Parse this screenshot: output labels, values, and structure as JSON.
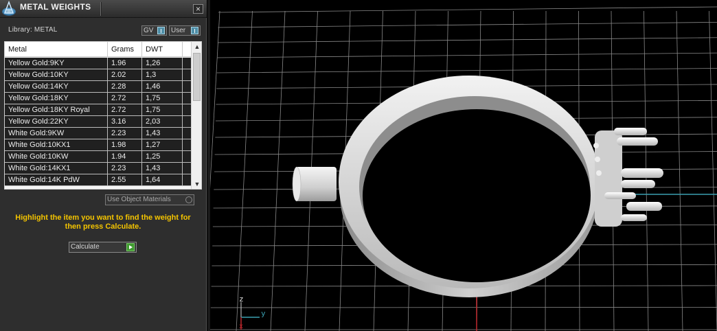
{
  "panel": {
    "title": "METAL WEIGHTS",
    "close_label": "×",
    "library_label": "Library: METAL",
    "toggles": {
      "gv_label": "GV",
      "user_label": "User"
    },
    "table": {
      "headers": [
        "Metal",
        "Grams",
        "DWT"
      ],
      "rows": [
        {
          "metal": "Yellow Gold:9KY",
          "grams": "1.96",
          "dwt": "1,26"
        },
        {
          "metal": "Yellow Gold:10KY",
          "grams": "2.02",
          "dwt": "1,3"
        },
        {
          "metal": "Yellow Gold:14KY",
          "grams": "2.28",
          "dwt": "1,46"
        },
        {
          "metal": "Yellow Gold:18KY",
          "grams": "2.72",
          "dwt": "1,75"
        },
        {
          "metal": "Yellow Gold:18KY Royal",
          "grams": "2.72",
          "dwt": "1,75"
        },
        {
          "metal": "Yellow Gold:22KY",
          "grams": "3.16",
          "dwt": "2,03"
        },
        {
          "metal": "White Gold:9KW",
          "grams": "2.23",
          "dwt": "1,43"
        },
        {
          "metal": "White Gold:10KX1",
          "grams": "1.98",
          "dwt": "1,27"
        },
        {
          "metal": "White Gold:10KW",
          "grams": "1.94",
          "dwt": "1,25"
        },
        {
          "metal": "White Gold:14KX1",
          "grams": "2.23",
          "dwt": "1,43"
        },
        {
          "metal": "White Gold:14K PdW",
          "grams": "2.55",
          "dwt": "1,64"
        }
      ]
    },
    "use_object_materials_label": "Use Object Materials",
    "instruction": "Highlight the item you want to find the weight for then press Calculate.",
    "calculate_label": "Calculate"
  },
  "viewport": {
    "axis_labels": {
      "z": "z",
      "y": "y",
      "x": "x"
    },
    "colors": {
      "grid": "#8a8a8a",
      "x_axis": "#c0282d",
      "y_axis": "#3a9fb0",
      "instruction_text": "#f4c400"
    }
  }
}
